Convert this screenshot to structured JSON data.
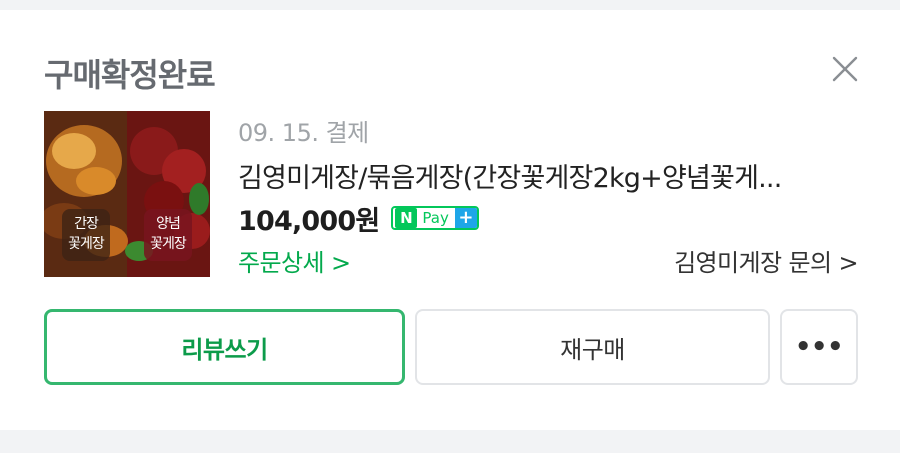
{
  "order": {
    "status_title": "구매확정완료",
    "payment_date": "09. 15. 결제",
    "product_name": "김영미게장/묶음게장(간장꽃게장2kg+양념꽃게...",
    "price": "104,000원",
    "thumbnail": {
      "label_left": [
        "간장",
        "꽃게장"
      ],
      "label_right": [
        "양념",
        "꽃게장"
      ]
    },
    "npay": {
      "n": "N",
      "pay": "Pay",
      "plus": "+"
    },
    "detail_link": "주문상세 >",
    "inquiry_link": "김영미게장 문의 >"
  },
  "actions": {
    "review": "리뷰쓰기",
    "rebuy": "재구매",
    "more": "•••"
  },
  "colors": {
    "accent_green": "#03c75a",
    "link_green": "#03a94c",
    "plus_blue": "#1ea6e8"
  },
  "icons": {
    "close": "close-icon",
    "more": "more-dots-icon"
  }
}
